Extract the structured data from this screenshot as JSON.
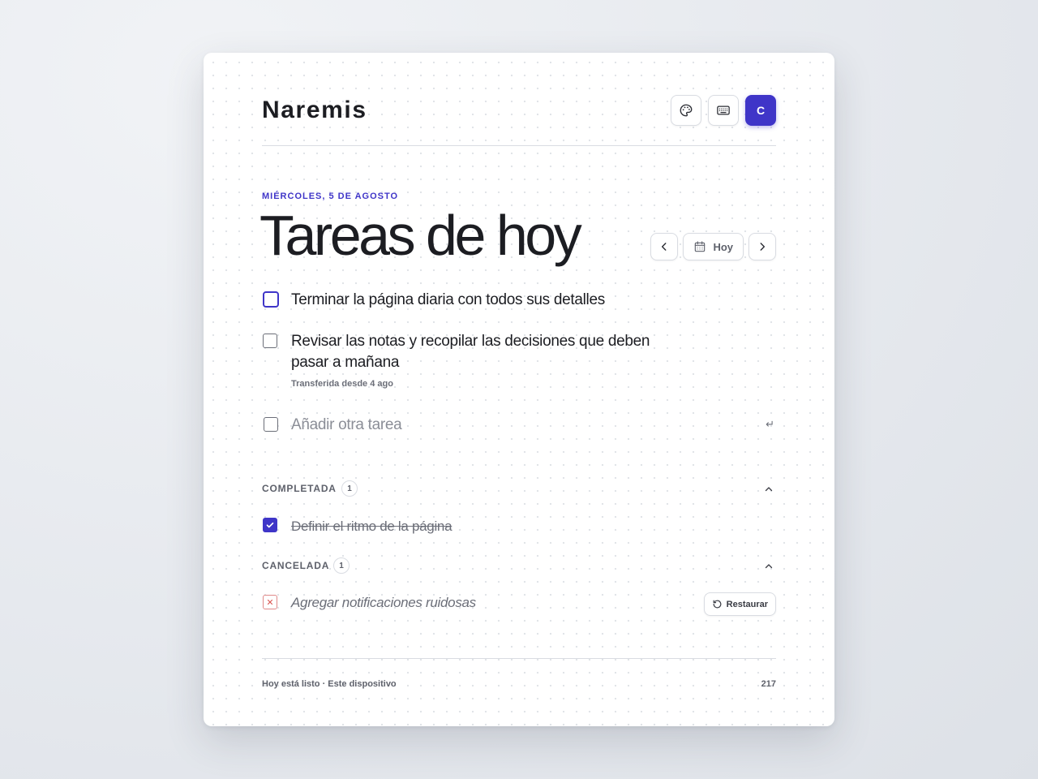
{
  "app": {
    "brand": "Naremis",
    "avatar_initial": "C"
  },
  "header": {
    "theme_icon": "palette-icon",
    "shortcuts_icon": "keyboard-icon"
  },
  "day": {
    "date_label": "MIÉRCOLES, 5 DE AGOSTO",
    "title": "Tareas de hoy",
    "today_label": "Hoy"
  },
  "tasks": [
    {
      "text": "Terminar la página diaria con todos sus detalles"
    },
    {
      "text_line1": "Revisar las notas y recopilar las decisiones que deben",
      "text_line2": "pasar a mañana",
      "meta": "Transferida desde 4 ago"
    }
  ],
  "add_task": {
    "placeholder": "Añadir otra tarea",
    "enter_hint": "↵"
  },
  "completed": {
    "title": "COMPLETADA",
    "count": "1",
    "items": [
      {
        "text": "Definir el ritmo de la página"
      }
    ]
  },
  "cancelled": {
    "title": "CANCELADA",
    "count": "1",
    "items": [
      {
        "text": "Agregar notificaciones ruidosas",
        "restore_label": "Restaurar"
      }
    ]
  },
  "footer": {
    "status": "Hoy está listo · Este dispositivo",
    "counter": "217"
  },
  "colors": {
    "accent": "#3f35c8",
    "cancel": "#d9534f"
  }
}
